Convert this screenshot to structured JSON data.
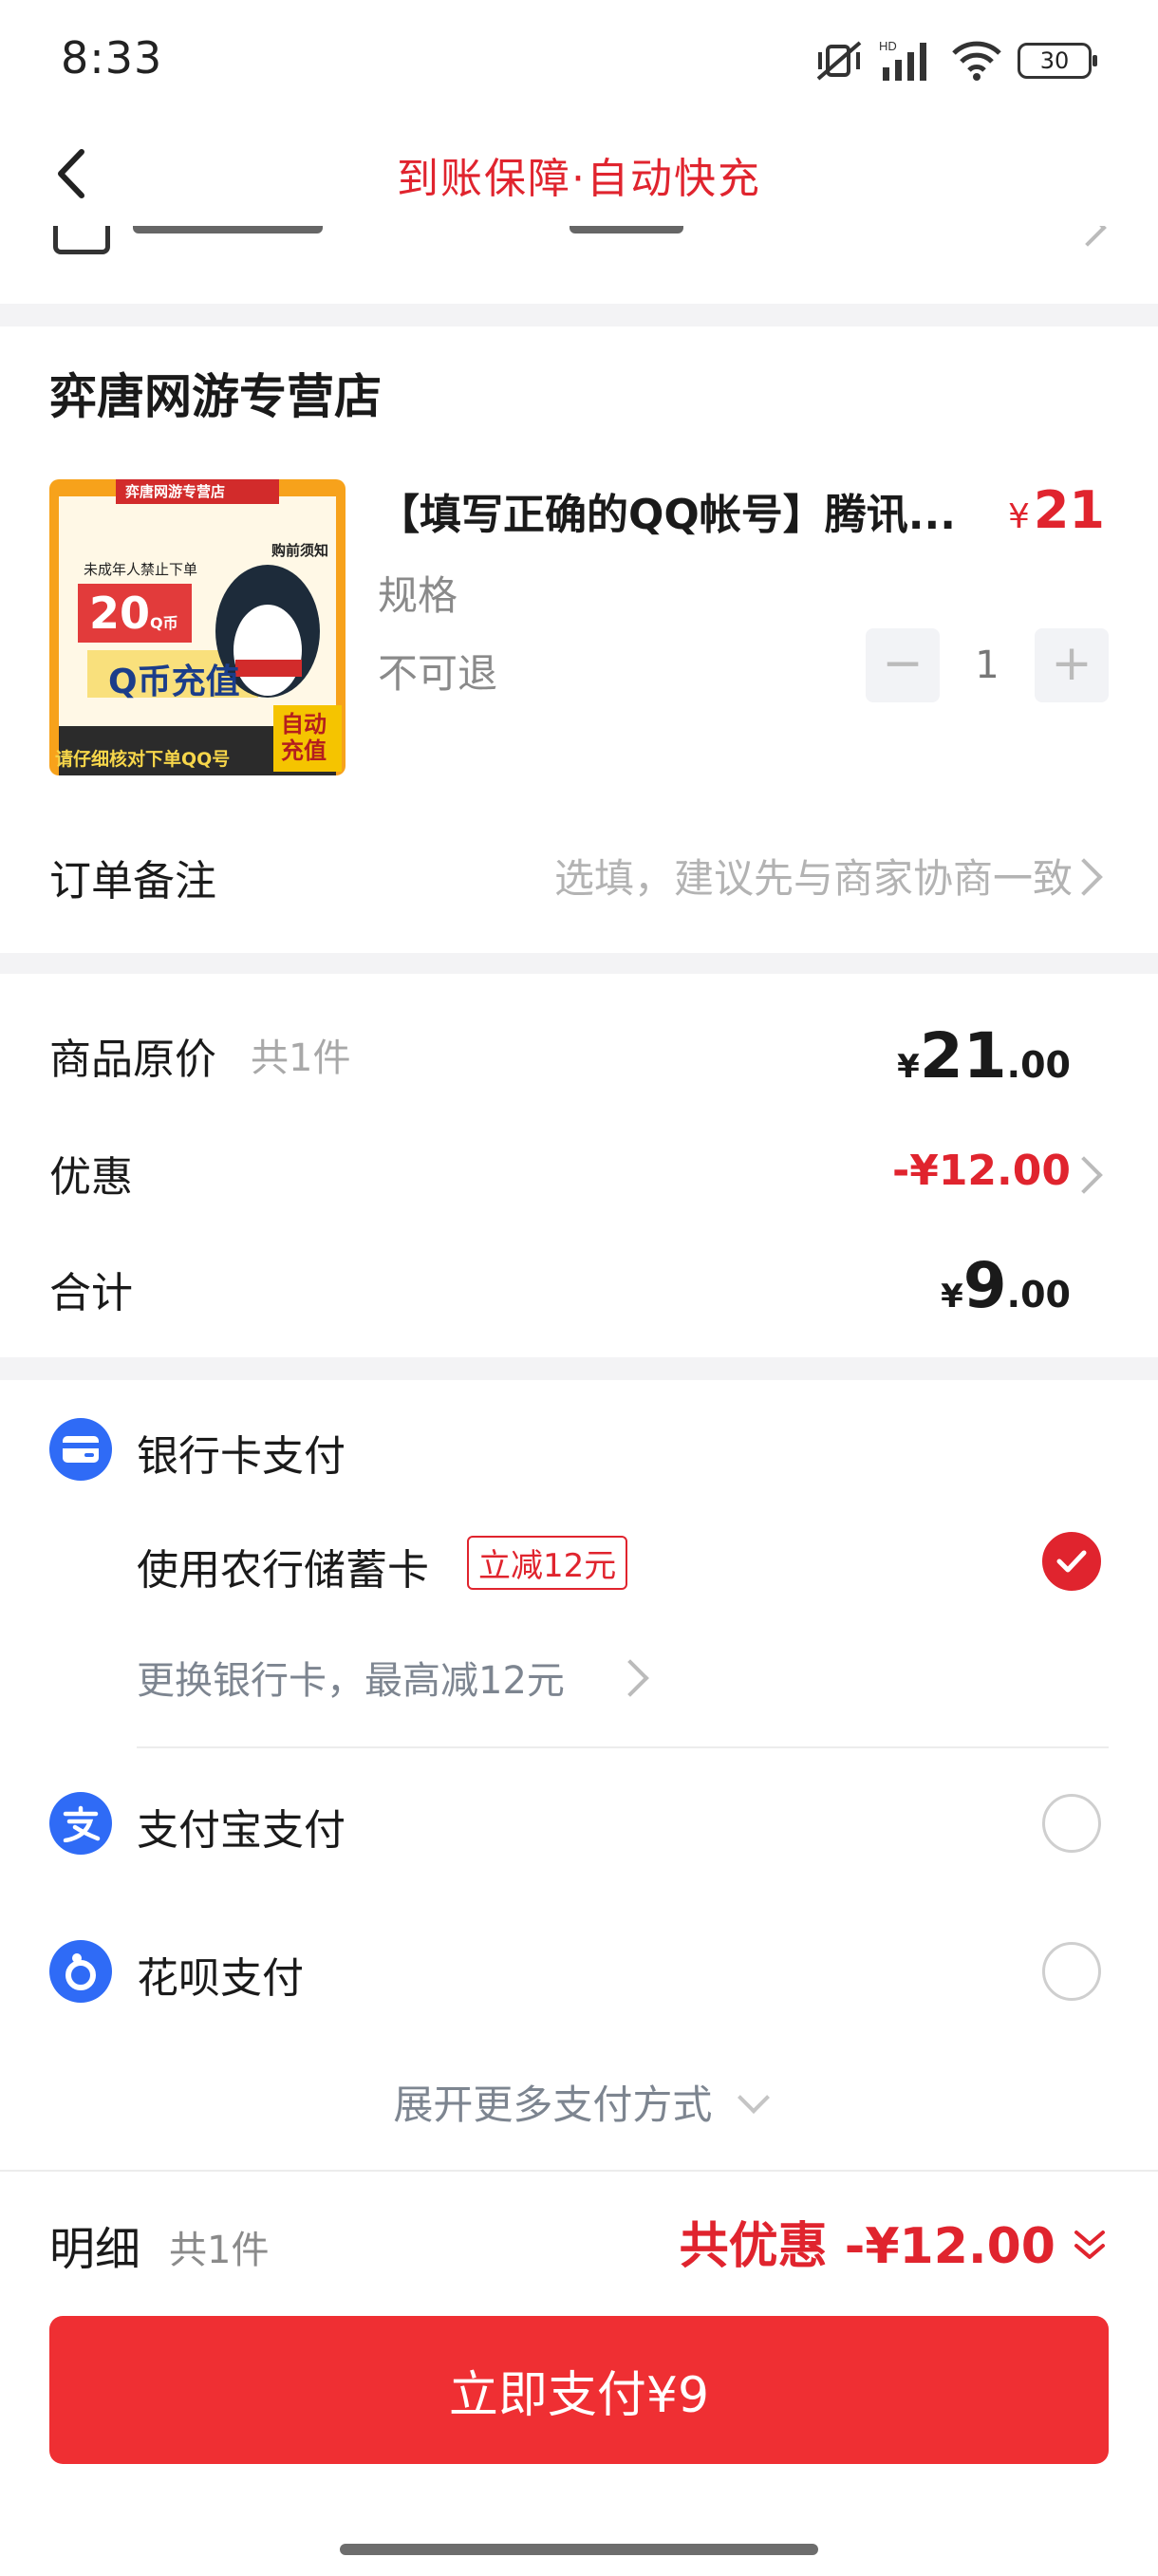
{
  "status_bar": {
    "time": "8:33",
    "battery": "30"
  },
  "nav": {
    "title": "到账保障·自动快充"
  },
  "shop": {
    "name": "弈唐网游专营店"
  },
  "product": {
    "title": "【填写正确的QQ帐号】腾讯...",
    "price_symbol": "¥",
    "price": "21",
    "spec_label": "规格",
    "refund_note": "不可退",
    "quantity": "1",
    "minus": "−",
    "plus": "+",
    "image_text": {
      "store": "弈唐网游专营店",
      "notice": "购前须知",
      "warn": "未成年人禁止下单",
      "coin": "20",
      "coin_unit": "Q币",
      "main": "Q币充值",
      "auto": "自动充值",
      "bottom": "请仔细核对下单QQ号"
    }
  },
  "memo": {
    "label": "订单备注",
    "placeholder": "选填，建议先与商家协商一致"
  },
  "summary": {
    "original_label": "商品原价",
    "original_count": "共1件",
    "original_cur": "¥",
    "original_int": "21",
    "original_dec": ".00",
    "discount_label": "优惠",
    "discount_value": "-¥12.00",
    "total_label": "合计",
    "total_cur": "¥",
    "total_int": "9",
    "total_dec": ".00"
  },
  "payment": {
    "bank_label": "银行卡支付",
    "bank_card": "使用农行储蓄卡",
    "bank_tag": "立减12元",
    "change_card": "更换银行卡，最高减12元",
    "alipay_label": "支付宝支付",
    "huabei_label": "花呗支付",
    "more": "展开更多支付方式"
  },
  "footer": {
    "detail_label": "明细",
    "detail_count": "共1件",
    "discount_total": "共优惠 -¥12.00",
    "pay_button": "立即支付¥9"
  },
  "colors": {
    "accent": "#e0242e",
    "button": "#ef2f33",
    "blue": "#2f6bf6"
  }
}
